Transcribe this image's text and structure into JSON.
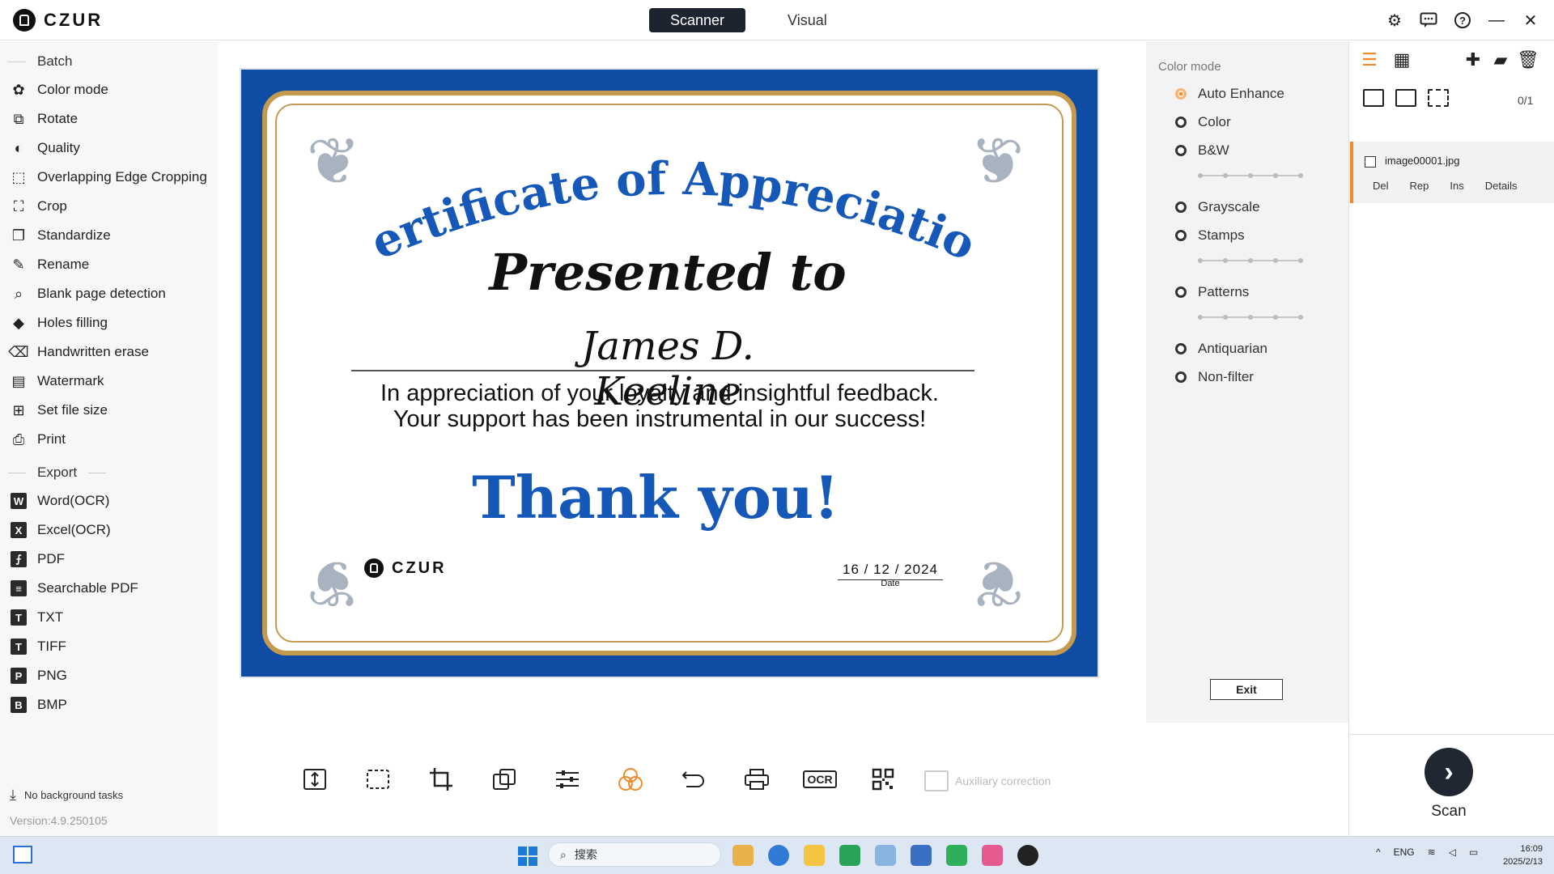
{
  "app": {
    "logo_text": "CZUR"
  },
  "mode_tabs": [
    {
      "label": "Scanner",
      "active": true
    },
    {
      "label": "Visual",
      "active": false
    }
  ],
  "window_controls": [
    "gear-icon",
    "feedback-icon",
    "help-icon",
    "minimize-icon",
    "close-icon"
  ],
  "sidebar": {
    "batch_title": "Batch",
    "batch_items": [
      {
        "label": "Color mode",
        "icon": "color-mode-icon"
      },
      {
        "label": "Rotate",
        "icon": "rotate-icon"
      },
      {
        "label": "Quality",
        "icon": "quality-icon"
      },
      {
        "label": "Overlapping Edge Cropping",
        "icon": "overlap-crop-icon"
      },
      {
        "label": "Crop",
        "icon": "crop-icon"
      },
      {
        "label": "Standardize",
        "icon": "standardize-icon"
      },
      {
        "label": "Rename",
        "icon": "rename-icon"
      },
      {
        "label": "Blank page detection",
        "icon": "blank-page-icon"
      },
      {
        "label": "Holes filling",
        "icon": "paint-bucket-icon"
      },
      {
        "label": "Handwritten erase",
        "icon": "eraser-icon"
      },
      {
        "label": "Watermark",
        "icon": "watermark-icon"
      },
      {
        "label": "Set file size",
        "icon": "file-size-icon"
      },
      {
        "label": "Print",
        "icon": "printer-icon"
      }
    ],
    "export_title": "Export",
    "export_items": [
      {
        "label": "Word(OCR)",
        "badge": "W"
      },
      {
        "label": "Excel(OCR)",
        "badge": "X"
      },
      {
        "label": "PDF",
        "badge": "⨍"
      },
      {
        "label": "Searchable PDF",
        "badge": "≡"
      },
      {
        "label": "TXT",
        "badge": "T"
      },
      {
        "label": "TIFF",
        "badge": "T"
      },
      {
        "label": "PNG",
        "badge": "P"
      },
      {
        "label": "BMP",
        "badge": "B"
      }
    ],
    "bg_tasks": "No background tasks",
    "version": "Version:4.9.250105"
  },
  "certificate": {
    "title": "Certificate of Appreciation",
    "subtitle": "Presented to",
    "name": "James D. Keeline",
    "message_line1": "In appreciation of your loyalty and insightful feedback.",
    "message_line2": "Your support has been instrumental in our success!",
    "thanks": "Thank you!",
    "logo_text": "CZUR",
    "date": "16 / 12 / 2024",
    "date_label": "Date"
  },
  "toolbar": {
    "buttons": [
      "fit-height-icon",
      "select-area-icon",
      "crop-icon",
      "rotate-icon",
      "adjust-icon",
      "color-mode-icon",
      "undo-icon",
      "print-icon",
      "ocr-icon",
      "qr-code-icon"
    ],
    "ocr_label": "OCR",
    "aux_label": "Auxiliary correction"
  },
  "color_mode": {
    "title": "Color mode",
    "options": [
      {
        "label": "Auto Enhance",
        "selected": true
      },
      {
        "label": "Color",
        "selected": false
      },
      {
        "label": "B&W",
        "selected": false
      },
      {
        "label": "Grayscale",
        "selected": false
      },
      {
        "label": "Stamps",
        "selected": false
      },
      {
        "label": "Patterns",
        "selected": false
      },
      {
        "label": "Antiquarian",
        "selected": false
      },
      {
        "label": "Non-filter",
        "selected": false
      }
    ],
    "exit_label": "Exit"
  },
  "file_panel": {
    "count": "0/1",
    "file_name": "image00001.jpg",
    "actions": [
      "Del",
      "Rep",
      "Ins",
      "Details"
    ],
    "scan_label": "Scan"
  },
  "taskbar": {
    "search_placeholder": "搜索",
    "lang": "ENG",
    "time": "16:09",
    "date": "2025/2/13"
  },
  "colors": {
    "accent": "#f28a2c",
    "cert_blue": "#0f4da5",
    "cert_gold": "#c49a4e",
    "dark_button": "#1d2430"
  }
}
